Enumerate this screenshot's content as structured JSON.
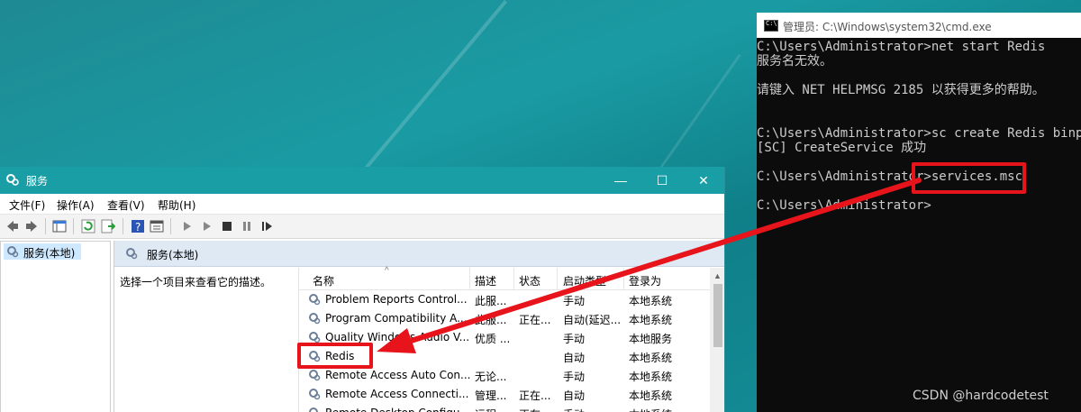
{
  "services_window": {
    "title": "服务",
    "menu": [
      "文件(F)",
      "操作(A)",
      "查看(V)",
      "帮助(H)"
    ],
    "tree_item": "服务(本地)",
    "pane_header": "服务(本地)",
    "description": "选择一个项目来查看它的描述。",
    "columns": [
      "名称",
      "描述",
      "状态",
      "启动类型",
      "登录为"
    ],
    "rows": [
      {
        "name": "Problem Reports Control...",
        "desc": "此服...",
        "status": "",
        "startup": "手动",
        "logon": "本地系统"
      },
      {
        "name": "Program Compatibility A...",
        "desc": "此服...",
        "status": "正在...",
        "startup": "自动(延迟...",
        "logon": "本地系统"
      },
      {
        "name": "Quality Windows Audio V...",
        "desc": "优质 ...",
        "status": "",
        "startup": "手动",
        "logon": "本地服务"
      },
      {
        "name": "Redis",
        "desc": "",
        "status": "",
        "startup": "自动",
        "logon": "本地系统"
      },
      {
        "name": "Remote Access Auto Con...",
        "desc": "无论...",
        "status": "",
        "startup": "手动",
        "logon": "本地系统"
      },
      {
        "name": "Remote Access Connecti...",
        "desc": "管理...",
        "status": "正在...",
        "startup": "自动",
        "logon": "本地系统"
      },
      {
        "name": "Remote Desktop Configu...",
        "desc": "远程...",
        "status": "正在...",
        "startup": "手动",
        "logon": "本地系统"
      }
    ]
  },
  "cmd_window": {
    "title": "管理员: C:\\Windows\\system32\\cmd.exe",
    "lines": [
      "C:\\Users\\Administrator>net start Redis",
      "服务名无效。",
      "",
      "请键入 NET HELPMSG 2185 以获得更多的帮助。",
      "",
      "",
      "C:\\Users\\Administrator>sc create Redis binpat",
      "[SC] CreateService 成功",
      "",
      "C:\\Users\\Administrator>services.msc",
      "",
      "C:\\Users\\Administrator>"
    ]
  },
  "watermark": "CSDN @hardcodetest",
  "colors": {
    "annotation_red": "#e8141c",
    "titlebar_teal": "#1a9ea6",
    "cmd_bg": "#0c0c0c"
  }
}
